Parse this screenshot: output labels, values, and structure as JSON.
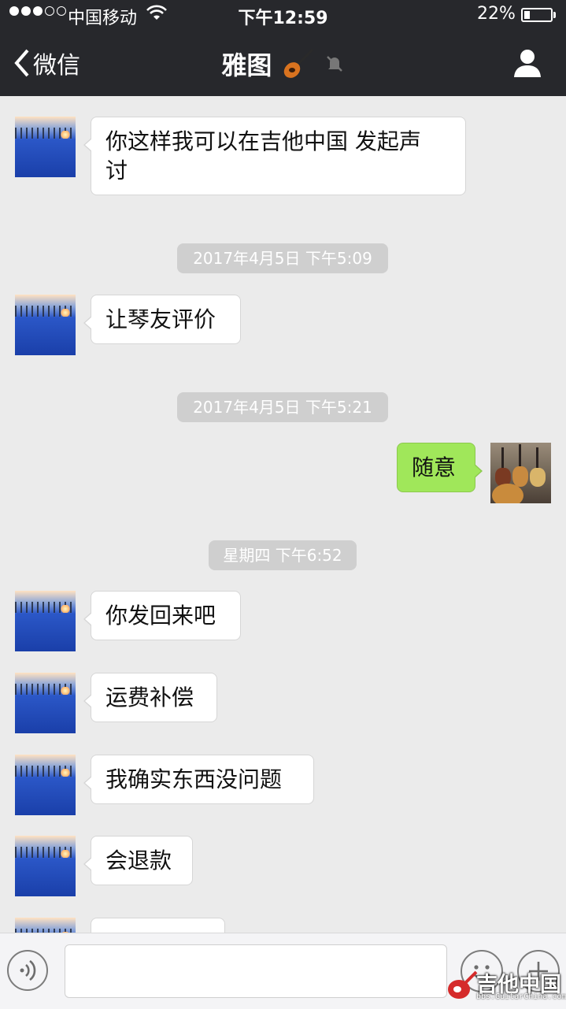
{
  "status_bar": {
    "signal_dots_filled": 3,
    "signal_dots_total": 5,
    "carrier": "中国移动",
    "time": "下午12:59",
    "battery_percent": "22%",
    "battery_level": 0.22
  },
  "nav": {
    "back_label": "微信",
    "title": "雅图",
    "title_icons": [
      "guitar-emoji-icon",
      "muted-bell-icon"
    ],
    "right_icon": "profile-icon"
  },
  "messages": [
    {
      "side": "left",
      "text_lines": [
        "你这样我可以在吉他中国 发起声",
        "讨"
      ]
    },
    {
      "type": "timestamp",
      "text": "2017年4月5日 下午5:09"
    },
    {
      "side": "left",
      "text": "让琴友评价"
    },
    {
      "type": "timestamp",
      "text": "2017年4月5日 下午5:21"
    },
    {
      "side": "right",
      "text": "随意"
    },
    {
      "type": "timestamp",
      "text": "星期四 下午6:52"
    },
    {
      "side": "left",
      "text": "你发回来吧"
    },
    {
      "side": "left",
      "text": "运费补偿"
    },
    {
      "side": "left",
      "text": "我确实东西没问题"
    },
    {
      "side": "left",
      "text": "会退款"
    }
  ],
  "input_bar": {
    "text_value": "",
    "icons": [
      "voice-icon",
      "emoji-icon",
      "plus-icon"
    ]
  },
  "watermark": {
    "brand": "吉他中国",
    "url": "bbs.GuitarChina.com"
  },
  "colors": {
    "nav_bg": "#27282c",
    "chat_bg": "#ebebeb",
    "bubble_in": "#ffffff",
    "bubble_out": "#a0e75a",
    "timestamp_bg": "#cfcfcf"
  }
}
